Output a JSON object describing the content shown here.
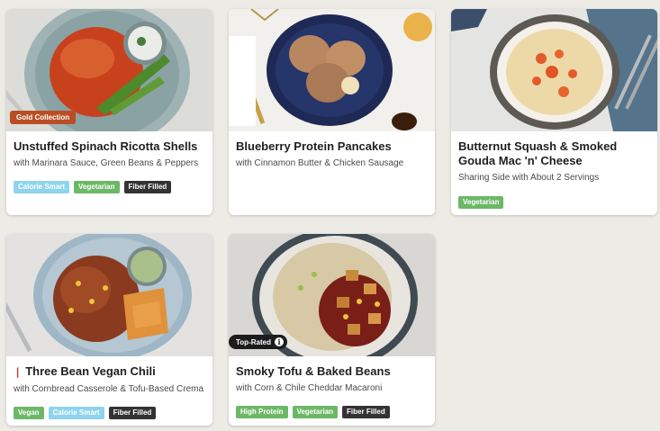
{
  "cards": [
    {
      "ribbon": "Gold Collection",
      "title": "Unstuffed Spinach Ricotta Shells",
      "subtitle": "with Marinara Sauce, Green Beans & Peppers",
      "tags": [
        "Calorie Smart",
        "Vegetarian",
        "Fiber Filled"
      ]
    },
    {
      "title": "Blueberry Protein Pancakes",
      "subtitle": "with Cinnamon Butter & Chicken Sausage",
      "tags": []
    },
    {
      "title": "Butternut Squash & Smoked Gouda Mac 'n' Cheese",
      "subtitle": "Sharing Side with About 2 Servings",
      "tags": [
        "Vegetarian"
      ]
    },
    {
      "title": "Three Bean Vegan Chili",
      "subtitle": "with Cornbread Casserole & Tofu-Based Crema",
      "tags": [
        "Vegan",
        "Calorie Smart",
        "Fiber Filled"
      ],
      "icon": "chili-pepper-icon"
    },
    {
      "badge": "Top-Rated",
      "title": "Smoky Tofu & Baked Beans",
      "subtitle": "with Corn & Chile Cheddar Macaroni",
      "tags": [
        "High Protein",
        "Vegetarian",
        "Fiber Filled"
      ]
    }
  ],
  "colors": {
    "tag_calorie_smart": "#8fd4ef",
    "tag_vegetarian": "#6cb866",
    "tag_fiber_filled": "#333333",
    "ribbon_gold": "#b94e24",
    "badge_top_rated": "#1c1c1c"
  }
}
